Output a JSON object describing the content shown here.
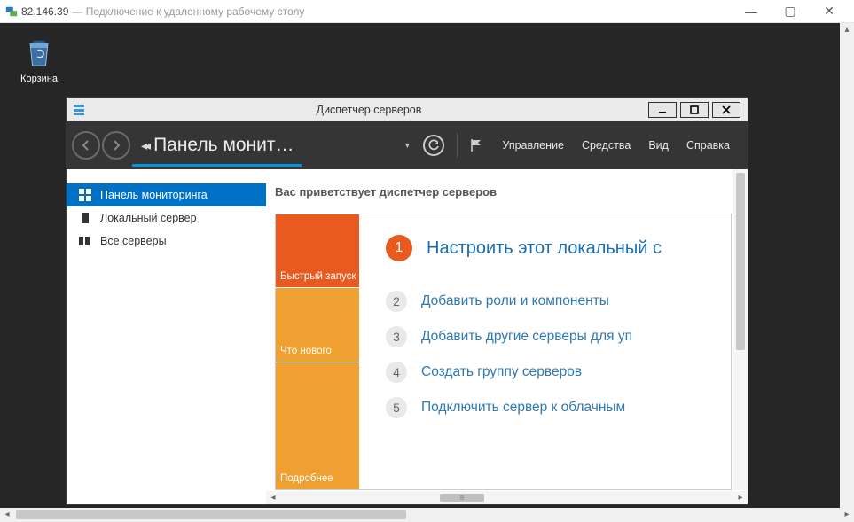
{
  "rdp": {
    "ip": "82.146.39",
    "subtitle": "— Подключение к удаленному рабочему столу"
  },
  "desktop": {
    "recycle_bin": "Корзина"
  },
  "server_manager": {
    "title": "Диспетчер серверов",
    "breadcrumb": "Панель монит…",
    "menus": {
      "manage": "Управление",
      "tools": "Средства",
      "view": "Вид",
      "help": "Справка"
    },
    "sidebar": {
      "dashboard": "Панель мониторинга",
      "local_server": "Локальный сервер",
      "all_servers": "Все серверы"
    },
    "welcome": "Вас приветствует диспетчер серверов",
    "left_blocks": {
      "quick_start": "Быстрый запуск",
      "whats_new": "Что нового",
      "learn_more": "Подробнее"
    },
    "tasks": {
      "t1": {
        "n": "1",
        "label": "Настроить этот локальный с"
      },
      "t2": {
        "n": "2",
        "label": "Добавить роли и компоненты"
      },
      "t3": {
        "n": "3",
        "label": "Добавить другие серверы для уп"
      },
      "t4": {
        "n": "4",
        "label": "Создать группу серверов"
      },
      "t5": {
        "n": "5",
        "label": "Подключить сервер к облачным"
      }
    }
  }
}
